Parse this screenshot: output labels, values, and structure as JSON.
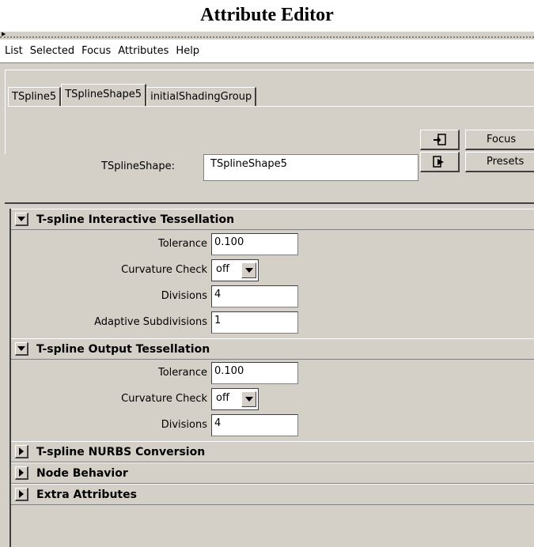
{
  "page_title": "Attribute Editor",
  "menubar": [
    "List",
    "Selected",
    "Focus",
    "Attributes",
    "Help"
  ],
  "tabs": [
    {
      "label": "TSpline5",
      "active": false
    },
    {
      "label": "TSplineShape5",
      "active": true
    },
    {
      "label": "initialShadingGroup",
      "active": false
    }
  ],
  "node": {
    "label": "TSplineShape:",
    "value": "TSplineShape5",
    "focus_button": "Focus",
    "presets_button": "Presets",
    "load_icon": "load-attributes-icon",
    "copy_icon": "copy-tab-icon"
  },
  "sections": [
    {
      "title": "T-spline Interactive Tessellation",
      "expanded": true,
      "attributes": [
        {
          "label": "Tolerance",
          "type": "field",
          "value": "0.100"
        },
        {
          "label": "Curvature Check",
          "type": "select",
          "value": "off"
        },
        {
          "label": "Divisions",
          "type": "field",
          "value": "4"
        },
        {
          "label": "Adaptive Subdivisions",
          "type": "field",
          "value": "1"
        }
      ]
    },
    {
      "title": "T-spline Output Tessellation",
      "expanded": true,
      "attributes": [
        {
          "label": "Tolerance",
          "type": "field",
          "value": "0.100"
        },
        {
          "label": "Curvature Check",
          "type": "select",
          "value": "off"
        },
        {
          "label": "Divisions",
          "type": "field",
          "value": "4"
        }
      ]
    },
    {
      "title": "T-spline NURBS Conversion",
      "expanded": false
    },
    {
      "title": "Node Behavior",
      "expanded": false
    },
    {
      "title": "Extra Attributes",
      "expanded": false
    }
  ]
}
